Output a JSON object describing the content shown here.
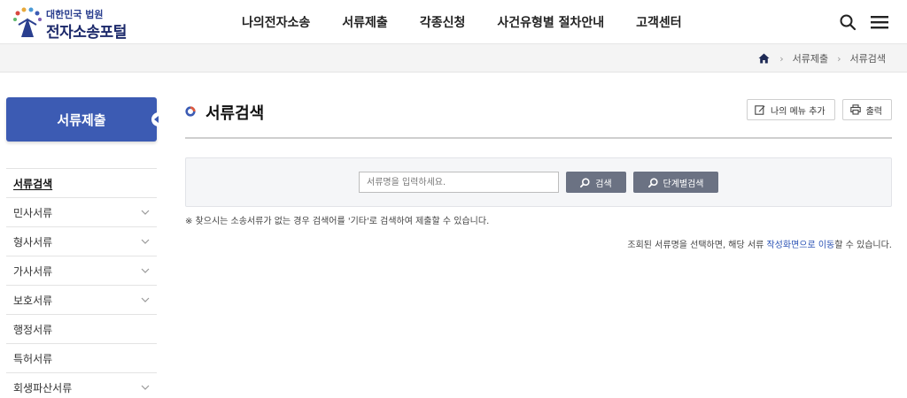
{
  "logo": {
    "sub": "대한민국 법원",
    "main": "전자소송포털"
  },
  "gnb": [
    {
      "label": "나의전자소송"
    },
    {
      "label": "서류제출"
    },
    {
      "label": "각종신청"
    },
    {
      "label": "사건유형별 절차안내"
    },
    {
      "label": "고객센터"
    }
  ],
  "header_icons": [
    "search-icon",
    "menu-icon"
  ],
  "breadcrumb": [
    "서류제출",
    "서류검색"
  ],
  "sidebar": {
    "title": "서류제출",
    "items": [
      {
        "label": "서류검색",
        "expandable": false,
        "active": true
      },
      {
        "label": "민사서류",
        "expandable": true,
        "active": false
      },
      {
        "label": "형사서류",
        "expandable": true,
        "active": false
      },
      {
        "label": "가사서류",
        "expandable": true,
        "active": false
      },
      {
        "label": "보호서류",
        "expandable": true,
        "active": false
      },
      {
        "label": "행정서류",
        "expandable": false,
        "active": false
      },
      {
        "label": "특허서류",
        "expandable": false,
        "active": false
      },
      {
        "label": "회생파산서류",
        "expandable": true,
        "active": false
      }
    ]
  },
  "page": {
    "title": "서류검색",
    "add_menu_label": "나의 메뉴 추가",
    "print_label": "출력"
  },
  "search": {
    "placeholder": "서류명을 입력하세요.",
    "value": "",
    "search_label": "검색",
    "step_search_label": "단계별검색"
  },
  "note": "※ 찾으시는 소송서류가 없는 경우 검색어를 '기타'로 검색하여 제출할 수 있습니다.",
  "info": {
    "before": "조회된 서류명을 선택하면, 해당 서류 ",
    "highlight": "작성화면으로 이동",
    "after": "할 수 있습니다."
  },
  "colors": {
    "brand": "#3c5bb3",
    "button": "#6b7283",
    "highlight": "#2b53b5"
  }
}
